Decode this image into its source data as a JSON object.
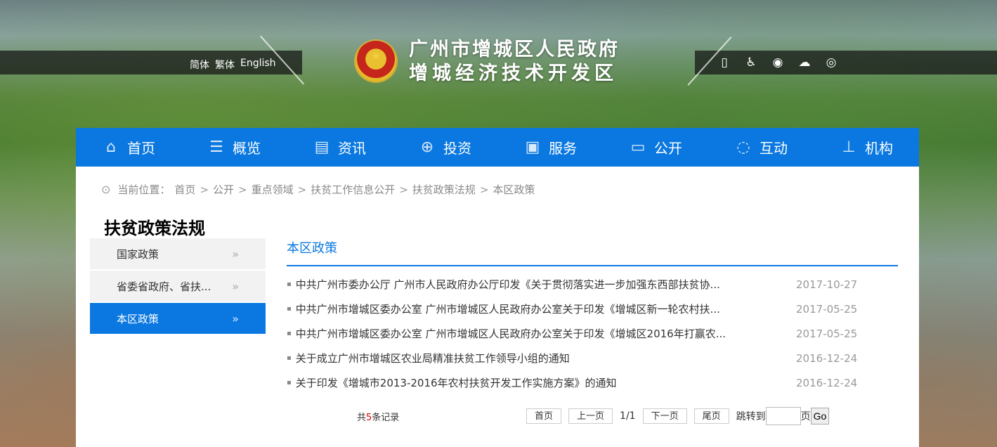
{
  "header": {
    "lang": [
      "简体",
      "繁体",
      "English"
    ],
    "title_line1": "广州市增城区人民政府",
    "title_line2": "增城经济技术开发区",
    "icons": [
      "mobile-icon",
      "accessibility-icon",
      "weibo-icon",
      "wechat-icon",
      "rss-icon"
    ]
  },
  "nav": [
    {
      "label": "首页",
      "icon": "home-icon"
    },
    {
      "label": "概览",
      "icon": "overview-icon"
    },
    {
      "label": "资讯",
      "icon": "news-icon"
    },
    {
      "label": "投资",
      "icon": "globe-icon"
    },
    {
      "label": "服务",
      "icon": "briefcase-icon"
    },
    {
      "label": "公开",
      "icon": "monitor-icon"
    },
    {
      "label": "互动",
      "icon": "chat-icon"
    },
    {
      "label": "机构",
      "icon": "org-chart-icon"
    }
  ],
  "breadcrumb": {
    "prefix": "当前位置：",
    "items": [
      "首页",
      "公开",
      "重点领域",
      "扶贫工作信息公开",
      "扶贫政策法规",
      "本区政策"
    ]
  },
  "sidebar": {
    "title": "扶贫政策法规",
    "items": [
      {
        "label": "国家政策"
      },
      {
        "label": "省委省政府、省扶..."
      },
      {
        "label": "本区政策"
      }
    ],
    "active_index": 2
  },
  "content": {
    "title": "本区政策",
    "list": [
      {
        "title": "中共广州市委办公厅 广州市人民政府办公厅印发《关于贯彻落实进一步加强东西部扶贫协...",
        "date": "2017-10-27"
      },
      {
        "title": "中共广州市增城区委办公室 广州市增城区人民政府办公室关于印发《增城区新一轮农村扶...",
        "date": "2017-05-25"
      },
      {
        "title": "中共广州市增城区委办公室 广州市增城区人民政府办公室关于印发《增城区2016年打赢农...",
        "date": "2017-05-25"
      },
      {
        "title": "关于成立广州市增城区农业局精准扶贫工作领导小组的通知",
        "date": "2016-12-24"
      },
      {
        "title": "关于印发《增城市2013-2016年农村扶贫开发工作实施方案》的通知",
        "date": "2016-12-24"
      }
    ]
  },
  "pager": {
    "total_prefix": "共",
    "total_count": "5",
    "total_suffix": "条记录",
    "first": "首页",
    "prev": "上一页",
    "page_info": "1/1",
    "next": "下一页",
    "last": "尾页",
    "jump_label": "跳转到",
    "jump_value": "",
    "page_unit": "页",
    "go": "Go"
  }
}
